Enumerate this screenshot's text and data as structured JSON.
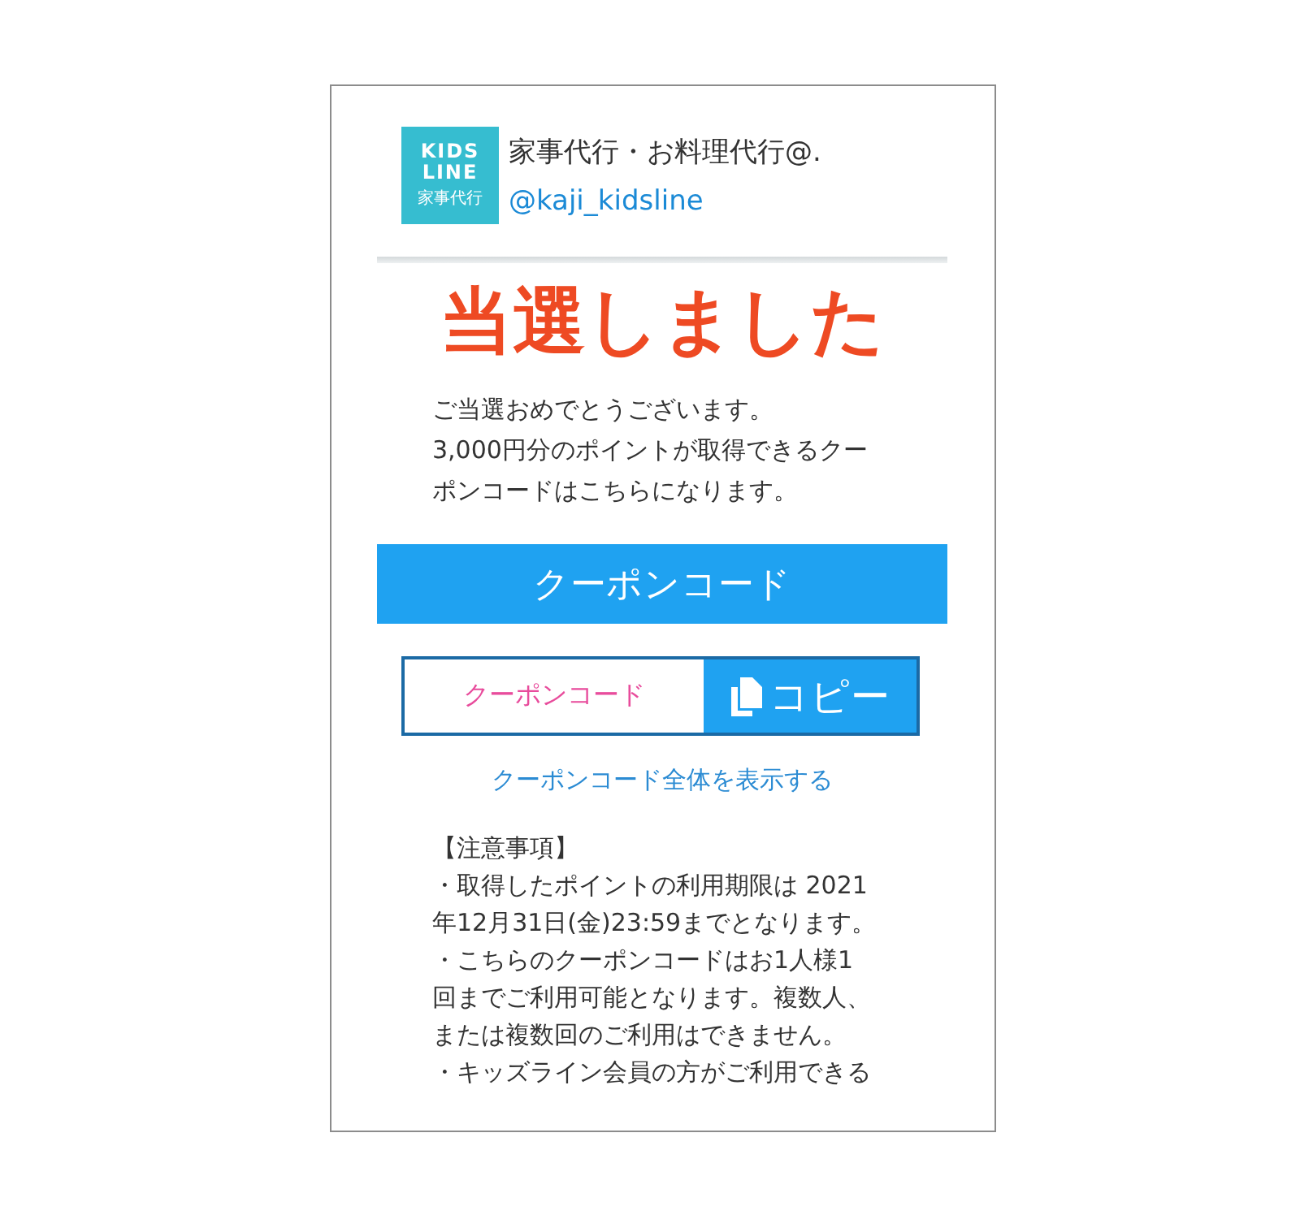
{
  "account": {
    "logo_text": [
      "KIDS",
      "LINE",
      "家事代行"
    ],
    "name": "家事代行・お料理代行@.",
    "handle": "@kaji_kidsline"
  },
  "title": "当選しました",
  "message": [
    "ご当選おめでとうございます。",
    "3,000円分のポイントが取得できるクー",
    "ポンコードはこちらになります。"
  ],
  "coupon": {
    "heading": "クーポンコード",
    "value": "クーポンコード",
    "copy_button": "コピー",
    "show_all_link": "クーポンコード全体を表示する"
  },
  "notes": {
    "heading": "【注意事項】",
    "items": [
      [
        "・取得したポイントの利用期限は 2021",
        "年12月31日(金)23:59までとなります。"
      ],
      [
        "・こちらのクーポンコードはお1人様1",
        "回までご利用可能となります。複数人、",
        "または複数回のご利用はできません。"
      ],
      [
        "・キッズライン会員の方がご利用できる"
      ]
    ]
  }
}
